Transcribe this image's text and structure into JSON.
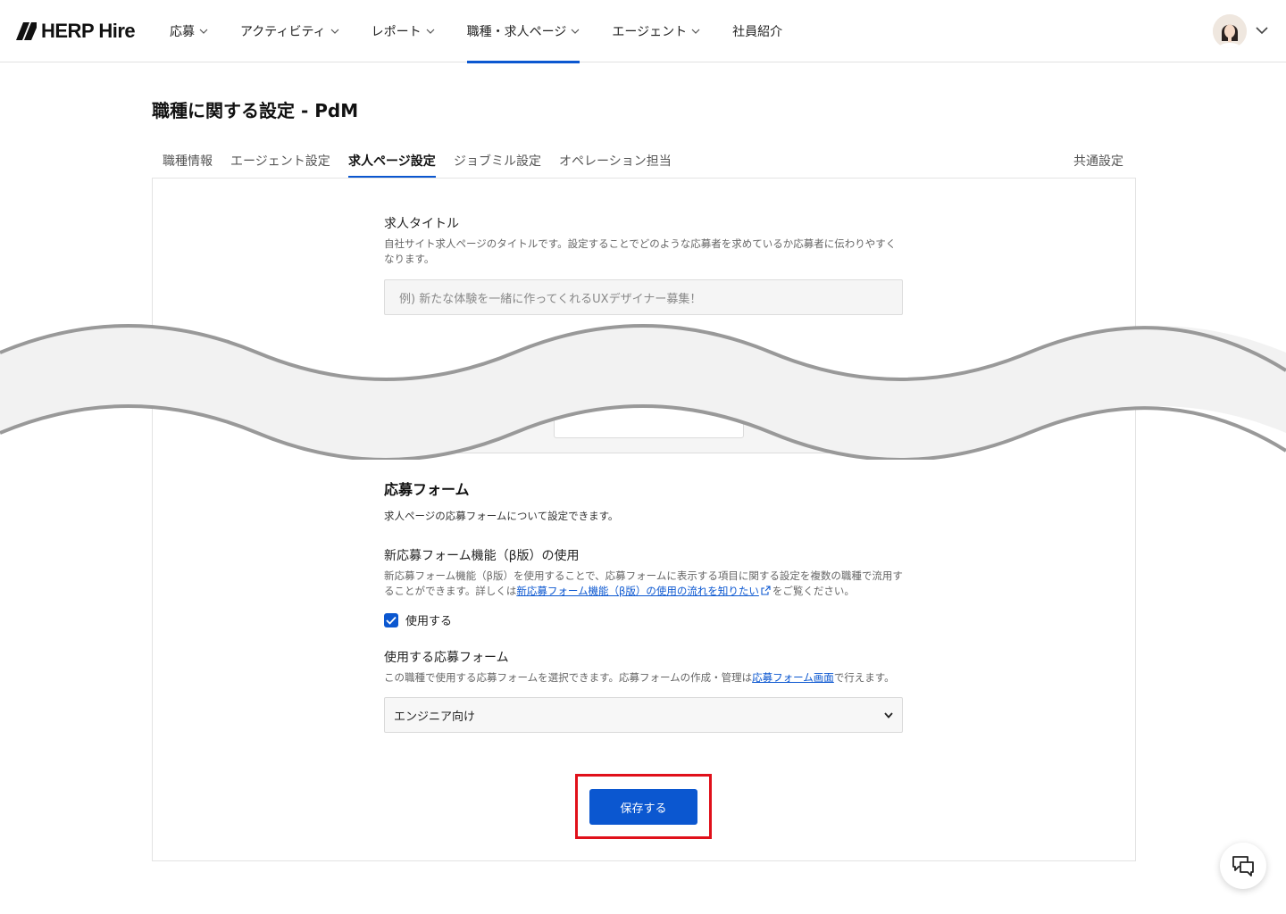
{
  "brand": {
    "name": "HERP Hire",
    "accent": "#0b57d0",
    "highlight": "#e0101a"
  },
  "nav": {
    "items": [
      {
        "label": "応募",
        "has_menu": true,
        "active": false
      },
      {
        "label": "アクティビティ",
        "has_menu": true,
        "active": false
      },
      {
        "label": "レポート",
        "has_menu": true,
        "active": false
      },
      {
        "label": "職種・求人ページ",
        "has_menu": true,
        "active": true
      },
      {
        "label": "エージェント",
        "has_menu": true,
        "active": false
      },
      {
        "label": "社員紹介",
        "has_menu": false,
        "active": false
      }
    ]
  },
  "page": {
    "title": "職種に関する設定 - PdM"
  },
  "tabs": {
    "items": [
      "職種情報",
      "エージェント設定",
      "求人ページ設定",
      "ジョブミル設定",
      "オペレーション担当"
    ],
    "active": "求人ページ設定",
    "right": "共通設定"
  },
  "job_title_field": {
    "label": "求人タイトル",
    "help": "自社サイト求人ページのタイトルです。設定することでどのような応募者を求めているか応募者に伝わりやすくなります。",
    "placeholder": "例) 新たな体験を一緒に作ってくれるUXデザイナー募集！"
  },
  "application_form": {
    "title": "応募フォーム",
    "description": "求人ページの応募フォームについて設定できます。",
    "new_form_feature": {
      "label": "新応募フォーム機能（β版）の使用",
      "help_prefix": "新応募フォーム機能（β版）を使用することで、応募フォームに表示する項目に関する設定を複数の職種で流用することができます。詳しくは",
      "help_link": "新応募フォーム機能（β版）の使用の流れを知りたい",
      "help_suffix": "をご覧ください。",
      "checkbox_label": "使用する",
      "checked": true
    },
    "form_select": {
      "label": "使用する応募フォーム",
      "help_prefix": "この職種で使用する応募フォームを選択できます。応募フォームの作成・管理は",
      "help_link": "応募フォーム画面",
      "help_suffix": "で行えます。",
      "selected": "エンジニア向け"
    }
  },
  "actions": {
    "save_label": "保存する"
  },
  "icons": {
    "chat": "chat-bubbles-icon",
    "chevron": "chevron-down-icon"
  }
}
